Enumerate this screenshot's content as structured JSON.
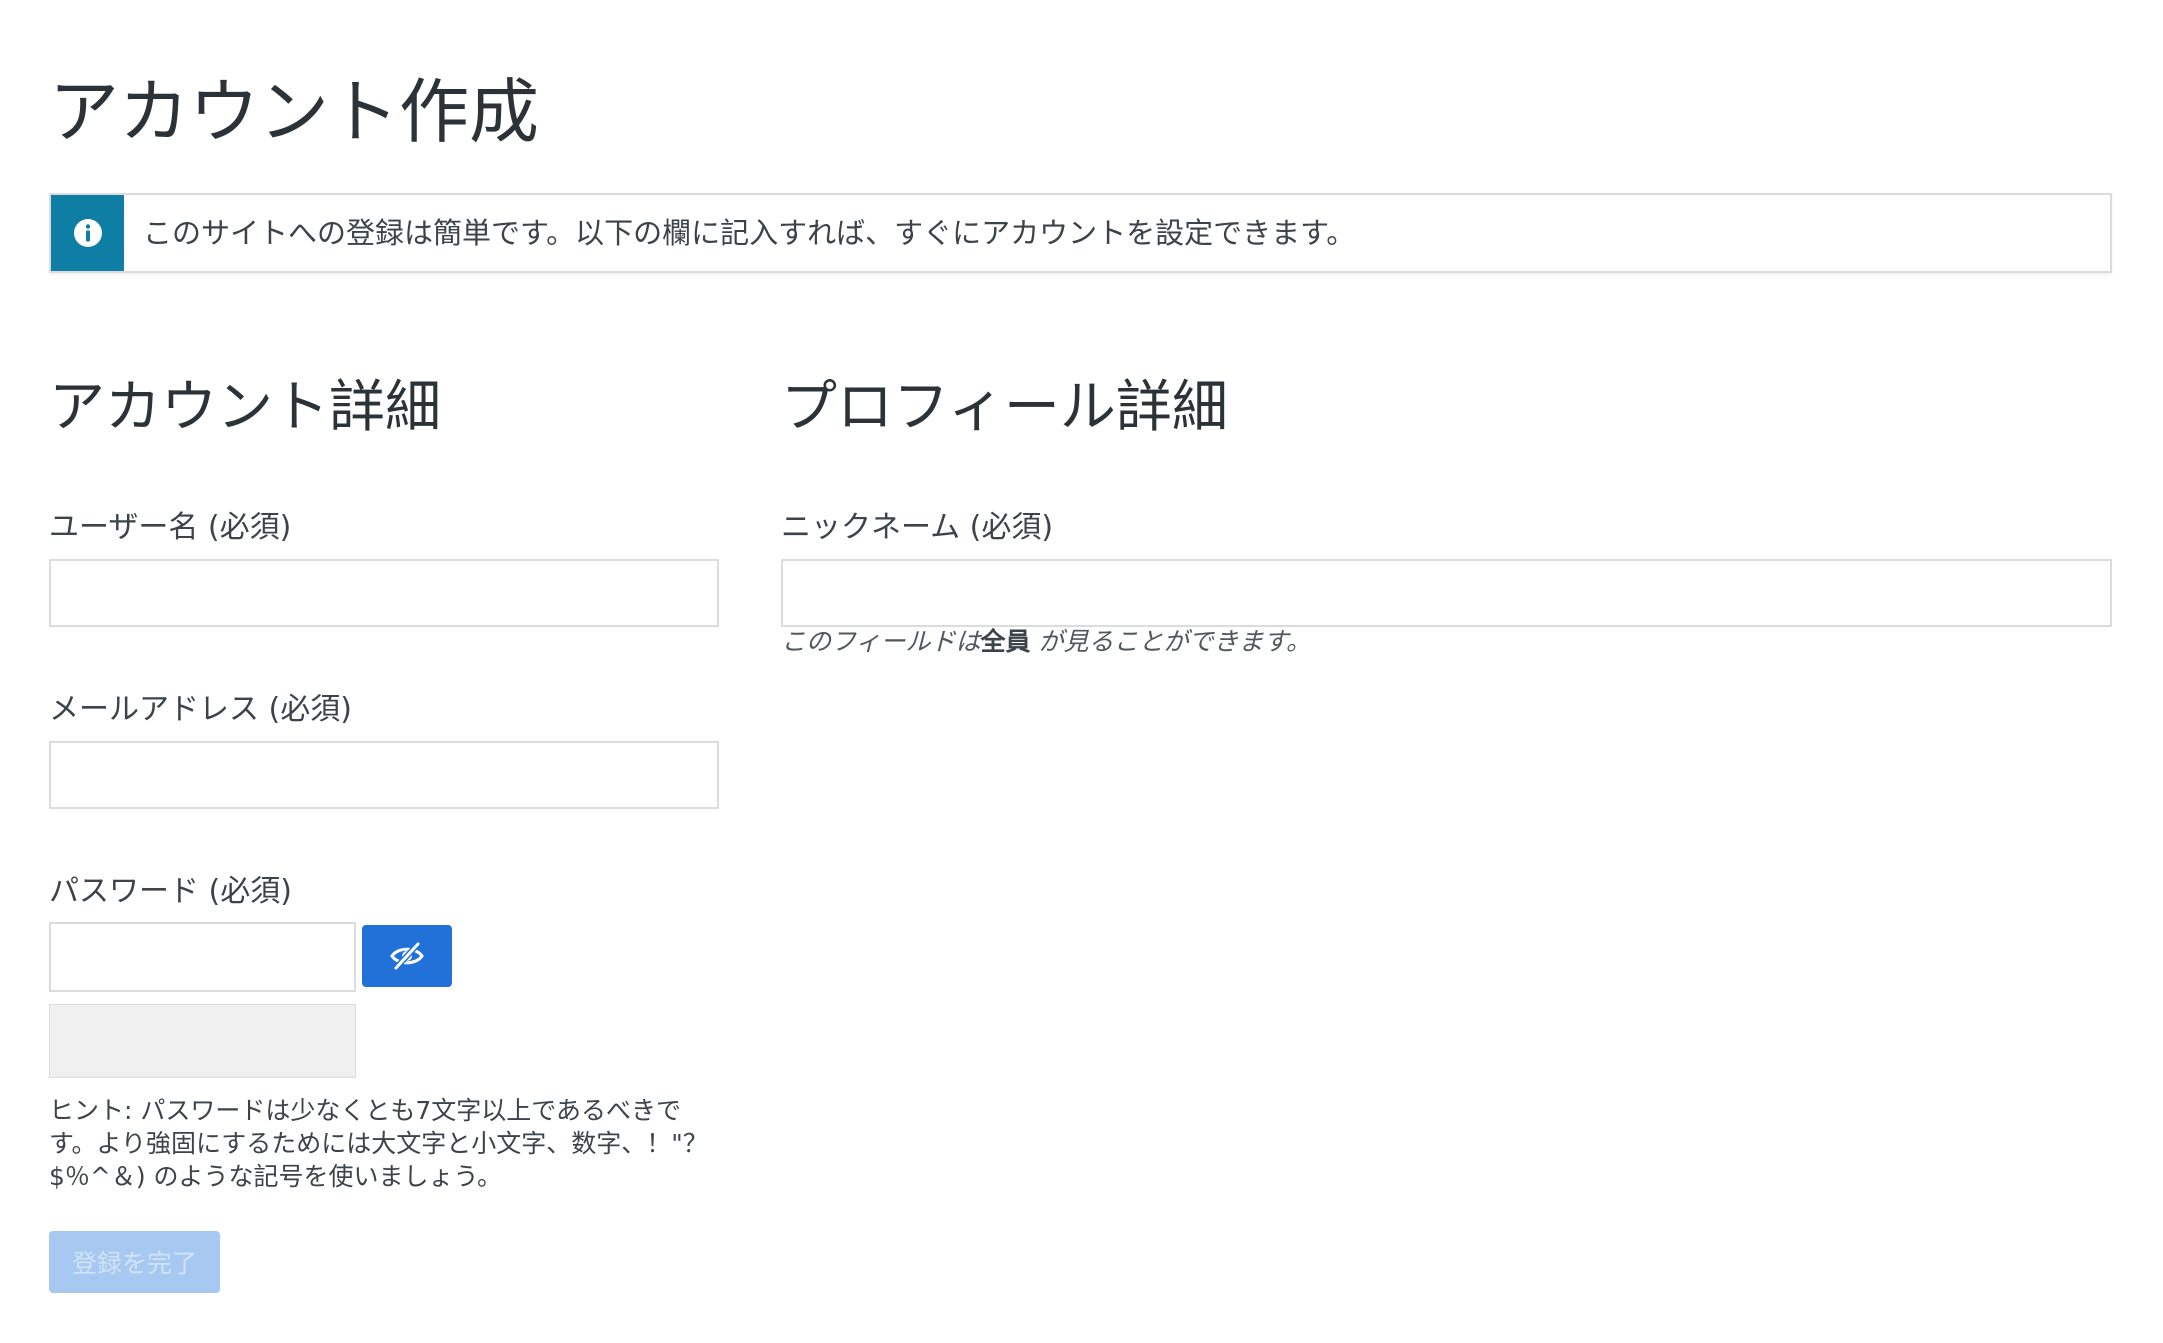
{
  "page": {
    "title": "アカウント作成"
  },
  "notice": {
    "icon": "info-icon",
    "text": "このサイトへの登録は簡単です。以下の欄に記入すれば、すぐにアカウントを設定できます。",
    "accent_color": "#0f7ea5"
  },
  "account_section": {
    "title": "アカウント詳細",
    "username_label": "ユーザー名 (必須)",
    "username_value": "",
    "email_label": "メールアドレス (必須)",
    "email_value": "",
    "password_label": "パスワード (必須)",
    "password_value": "",
    "password_toggle_icon": "eye-slash-icon",
    "hint_lines": [
      "ヒント: パスワードは少なくとも7文字以上であるべきで",
      "す。より強固にするためには大文字と小文字、数字、！\"？",
      "$％^＆) のような記号を使いましょう。"
    ],
    "submit_label": "登録を完了",
    "button_color": "#2271d9"
  },
  "profile_section": {
    "title": "プロフィール詳細",
    "nickname_label": "ニックネーム (必須)",
    "nickname_value": "",
    "visibility_prefix": "このフィールドは",
    "visibility_strong": "全員",
    "visibility_suffix": "が見ることができます。"
  }
}
